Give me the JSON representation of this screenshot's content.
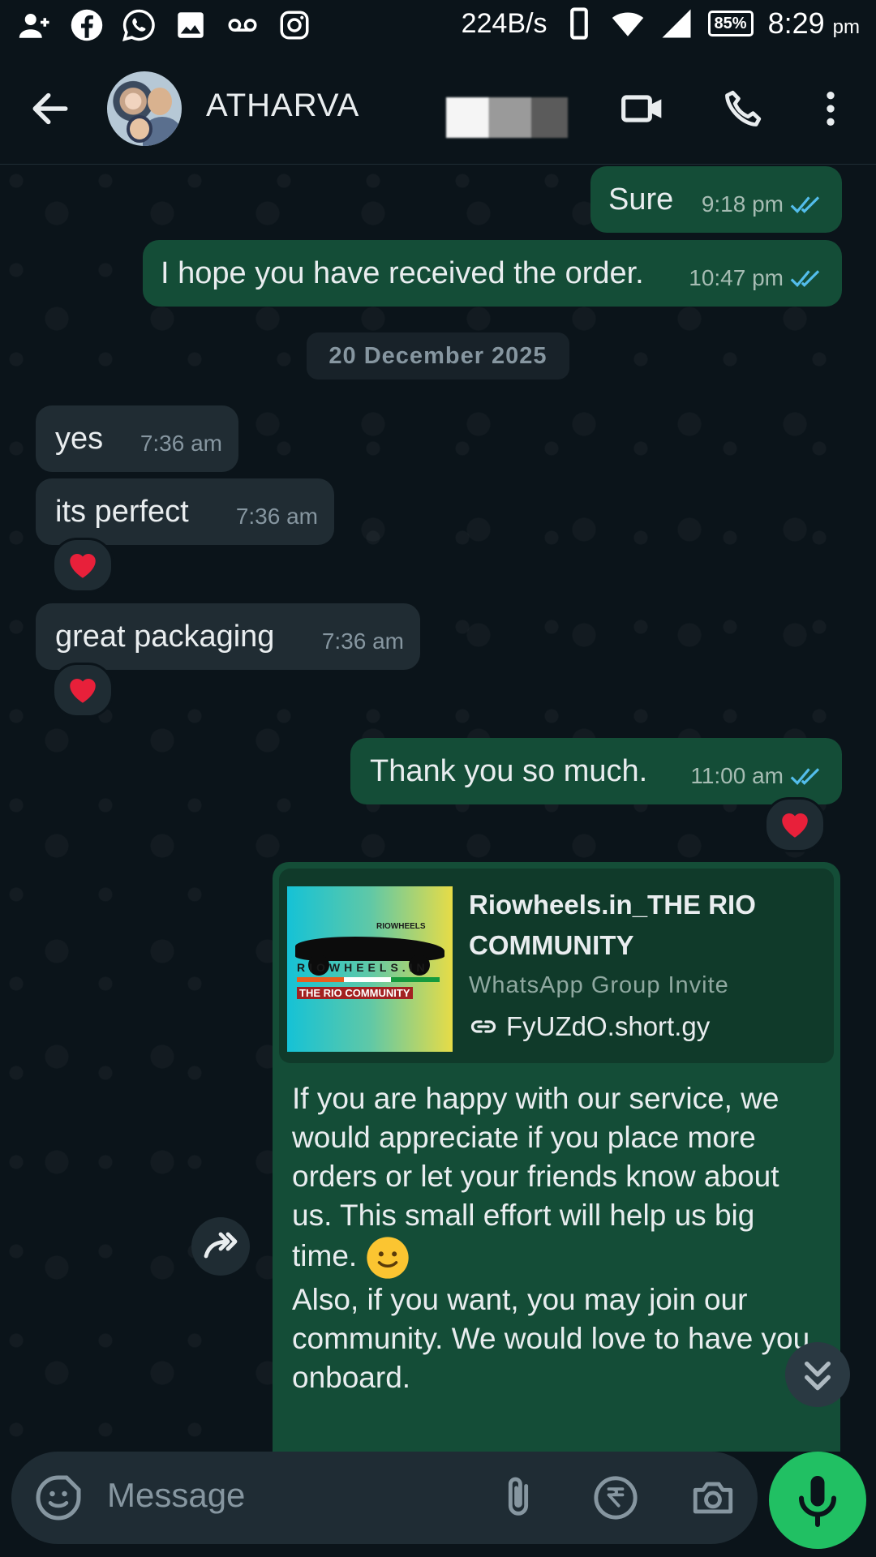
{
  "status_bar": {
    "net_speed": "224B/s",
    "battery": "85%",
    "time": "8:29",
    "ampm": "pm"
  },
  "header": {
    "contact_name": "ATHARVA"
  },
  "messages": [
    {
      "dir": "out",
      "text": "Sure",
      "time": "9:18 pm",
      "status": "read"
    },
    {
      "dir": "out",
      "text": "I hope you have received the order.",
      "time": "10:47 pm",
      "status": "read"
    },
    {
      "dir": "in",
      "text": "yes",
      "time": "7:36 am"
    },
    {
      "dir": "in",
      "text": "its perfect",
      "time": "7:36 am",
      "reaction": "heart"
    },
    {
      "dir": "in",
      "text": "great packaging",
      "time": "7:36 am",
      "reaction": "heart"
    },
    {
      "dir": "out",
      "text": "Thank you so much.",
      "time": "11:00 am",
      "status": "read",
      "reaction": "heart"
    }
  ],
  "date_divider": "20 December 2025",
  "invite": {
    "title": "Riowheels.in_THE RIO COMMUNITY",
    "subtitle": "WhatsApp Group Invite",
    "link": "FyUZdO.short.gy",
    "thumb_brand": "RIOWHEELS.IN",
    "thumb_small": "RIOWHEELS",
    "thumb_community": "THE RIO COMMUNITY",
    "body_p1": "If you are happy with our service, we would appreciate if you place more orders or let your friends know about us. This small effort will help us big time.",
    "body_p2": "Also, if you want, you may join our community. We would love to have you onboard."
  },
  "composer": {
    "placeholder": "Message"
  },
  "colors": {
    "background": "#0b141a",
    "outgoing_bubble": "#144d37",
    "incoming_bubble": "#202c33",
    "read_ticks": "#53bdeb",
    "mic_button": "#21c063"
  }
}
